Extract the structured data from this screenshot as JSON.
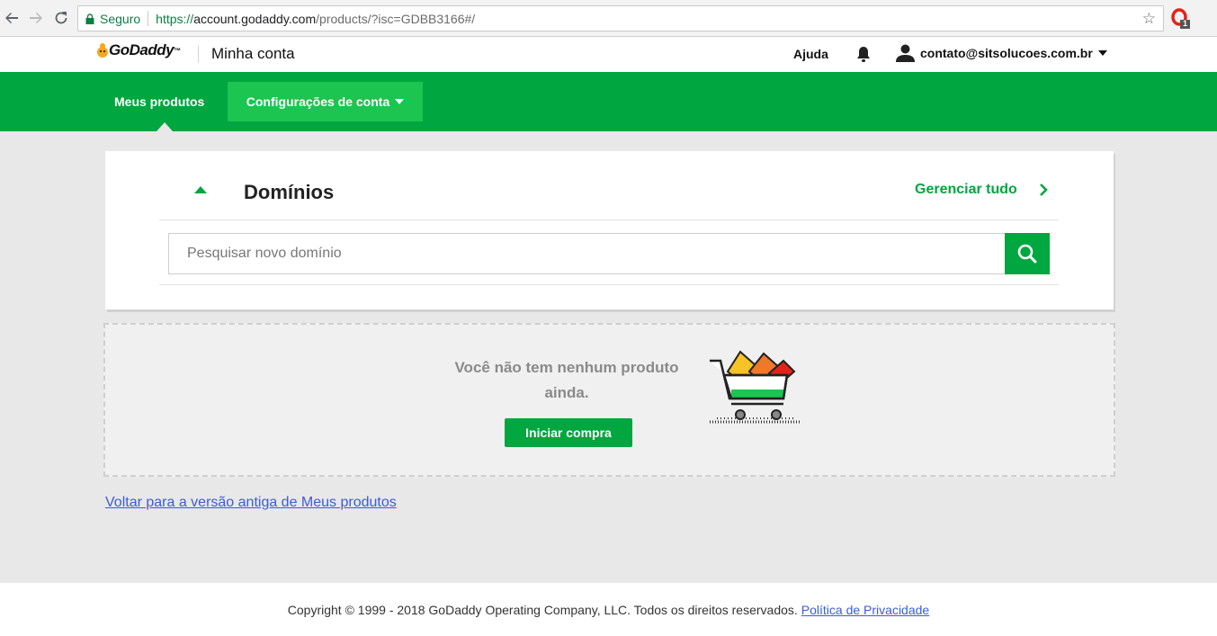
{
  "browser": {
    "secure_label": "Seguro",
    "url_scheme": "https://",
    "url_domain": "account.godaddy.com",
    "url_path": "/products/?isc=GDBB3166#/",
    "extension_badge": "1"
  },
  "header": {
    "logo_text": "GoDaddy",
    "logo_tm": "™",
    "section_title": "Minha conta",
    "help_label": "Ajuda",
    "user_email": "contato@sitsolucoes.com.br"
  },
  "nav": {
    "products_label": "Meus produtos",
    "settings_label": "Configurações de conta"
  },
  "domains_card": {
    "title": "Domínios",
    "manage_all_label": "Gerenciar tudo",
    "search_placeholder": "Pesquisar novo domínio"
  },
  "empty_state": {
    "message": "Você não tem nenhum produto ainda.",
    "button_label": "Iniciar compra"
  },
  "old_version_link": "Voltar para a versão antiga de Meus produtos",
  "footer": {
    "copyright": "Copyright © 1999 - 2018 GoDaddy Operating Company, LLC. Todos os direitos reservados.",
    "privacy_link": "Política de Privacidade"
  },
  "colors": {
    "brand_green": "#00a63f",
    "nav_highlight": "#1bc550",
    "link_blue": "#3b5bdb"
  }
}
